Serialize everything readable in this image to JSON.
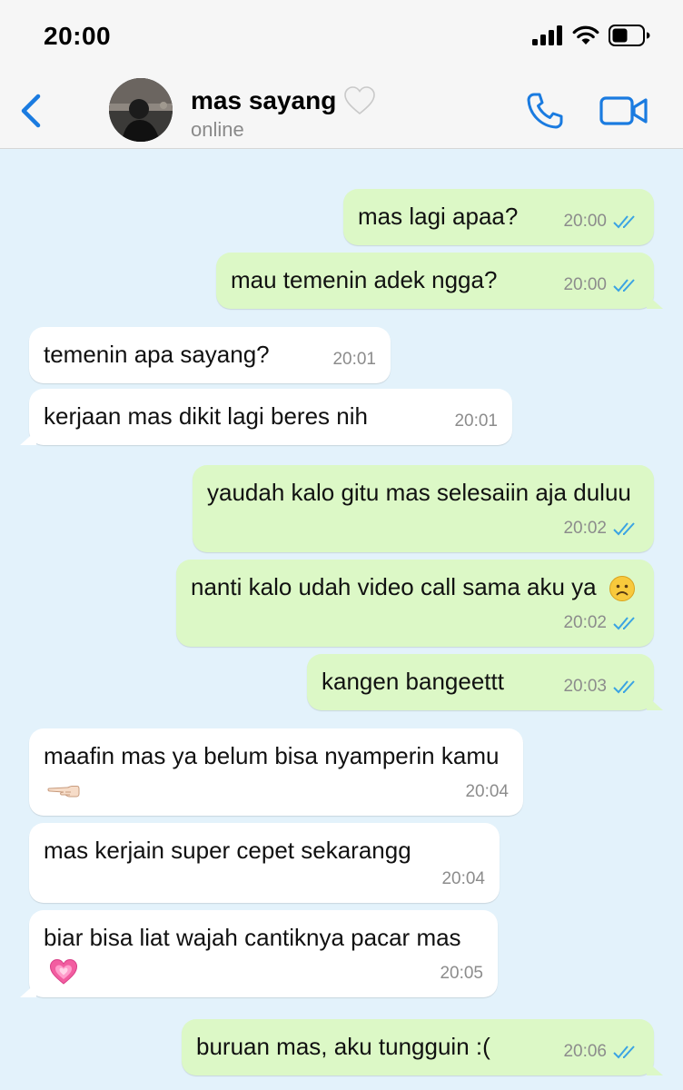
{
  "status_bar": {
    "time": "20:00"
  },
  "header": {
    "contact_name": "mas sayang",
    "contact_status": "online"
  },
  "colors": {
    "accent": "#1a7be0",
    "outgoing_bubble": "#dcf8c6",
    "incoming_bubble": "#ffffff",
    "chat_background": "#e3f2fb",
    "read_ticks": "#3aa3e3"
  },
  "messages": [
    {
      "direction": "out",
      "text": "mas lagi apaa?",
      "time": "20:00",
      "read": true
    },
    {
      "direction": "out",
      "text": "mau temenin adek ngga?",
      "time": "20:00",
      "read": true
    },
    {
      "direction": "in",
      "text": "temenin apa sayang?",
      "time": "20:01"
    },
    {
      "direction": "in",
      "text": "kerjaan mas dikit lagi beres nih",
      "time": "20:01"
    },
    {
      "direction": "out",
      "text": "yaudah kalo gitu mas selesaiin aja duluu",
      "time": "20:02",
      "read": true
    },
    {
      "direction": "out",
      "text": "nanti kalo udah video call sama aku ya",
      "emoji": "frowning-face",
      "time": "20:02",
      "read": true
    },
    {
      "direction": "out",
      "text": "kangen bangeettt",
      "time": "20:03",
      "read": true
    },
    {
      "direction": "in",
      "text": "maafin mas ya belum bisa nyamperin kamu",
      "emoji": "pointing-left-hand",
      "time": "20:04"
    },
    {
      "direction": "in",
      "text": "mas kerjain super cepet sekarangg",
      "time": "20:04"
    },
    {
      "direction": "in",
      "text": "biar bisa liat wajah cantiknya pacar mas",
      "emoji": "growing-heart",
      "time": "20:05"
    },
    {
      "direction": "out",
      "text": "buruan mas, aku tungguin :(",
      "time": "20:06",
      "read": true
    }
  ]
}
